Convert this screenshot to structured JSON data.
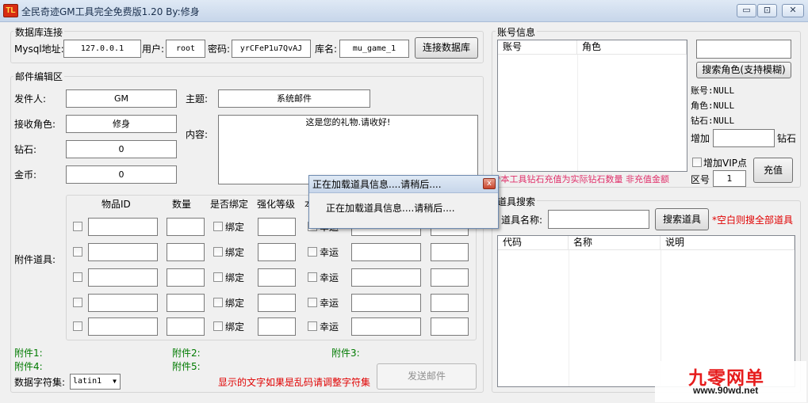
{
  "window": {
    "icon": "app-logo-icon",
    "title": "全民奇迹GM工具完全免费版1.20  By:修身",
    "minimize_glyph": "▭",
    "maximize_glyph": "⊡",
    "close_glyph": "✕"
  },
  "db": {
    "title": "数据库连接",
    "mysql_label": "Mysql地址:",
    "mysql_value": "127.0.0.1",
    "user_label": "用户:",
    "user_value": "root",
    "pass_label": "密码:",
    "pass_value": "yrCFeP1u7QvAJ",
    "dbname_label": "库名:",
    "dbname_value": "mu_game_1",
    "connect_label": "连接数据库"
  },
  "mail": {
    "title": "邮件编辑区",
    "sender_label": "发件人:",
    "sender_value": "GM",
    "subject_label": "主题:",
    "subject_value": "系统邮件",
    "receiver_label": "接收角色:",
    "receiver_value": "修身",
    "content_label": "内容:",
    "content_value": "这是您的礼物.请收好!",
    "diamond_label": "钻石:",
    "diamond_value": "0",
    "gold_label": "金币:",
    "gold_value": "0",
    "attach_label": "附件道具:",
    "col_item_id": "物品ID",
    "col_qty": "数量",
    "col_bind": "是否绑定",
    "col_enhance": "强化等级",
    "col_obscured": "本",
    "bind_label": "绑定",
    "luck_label": "幸运",
    "att1": "附件1:",
    "att2": "附件2:",
    "att3": "附件3:",
    "att4": "附件4:",
    "att5": "附件5:",
    "charset_label": "数据字符集:",
    "charset_value": "latin1",
    "charset_note": "显示的文字如果是乱码请调整字符集",
    "send_label": "发送邮件"
  },
  "account": {
    "title": "账号信息",
    "col_account": "账号",
    "col_role": "角色",
    "search_label": "搜索角色(支持模糊)",
    "account_info": "账号:NULL",
    "role_info": "角色:NULL",
    "diamond_info": "钻石:NULL",
    "add_label": "增加",
    "diamond_unit": "钻石",
    "vip_label": "增加VIP点",
    "recharge_label": "充值",
    "note": "*本工具钻石充值为实际钻石数量 非充值金额",
    "zone_label": "区号",
    "zone_value": "1"
  },
  "items": {
    "title": "道具搜索",
    "name_label": "道具名称:",
    "search_label": "搜索道具",
    "hint": "*空白则搜全部道具",
    "col_code": "代码",
    "col_name": "名称",
    "col_desc": "说明"
  },
  "dialog": {
    "title": "正在加载道具信息....请稍后....",
    "message": "正在加载道具信息....请稍后....",
    "close_glyph": "x"
  },
  "watermark": {
    "line1": "九零网单",
    "line2": "www.90wd.net"
  }
}
